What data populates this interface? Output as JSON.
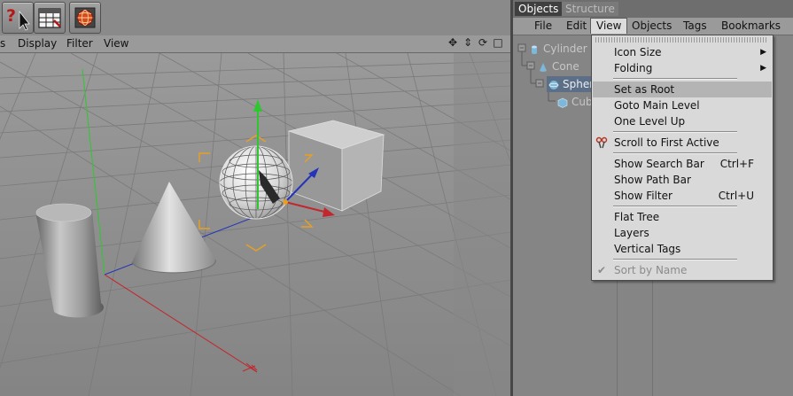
{
  "viewport": {
    "menus": [
      "s",
      "Display",
      "Filter",
      "View"
    ],
    "nav_icons": [
      "move-view-icon",
      "zoom-view-icon",
      "rotate-view-icon",
      "maximize-view-icon"
    ]
  },
  "toolbar": {
    "buttons": [
      "help-cursor-icon",
      "render-settings-icon",
      "render-view-icon"
    ]
  },
  "object_manager": {
    "tabs": [
      "Objects",
      "Structure"
    ],
    "menus": [
      "File",
      "Edit",
      "View",
      "Objects",
      "Tags",
      "Bookmarks"
    ],
    "open_menu": "View",
    "tree": [
      {
        "label": "Cylinder",
        "icon": "cylinder-icon",
        "selected": false
      },
      {
        "label": "Cone",
        "icon": "cone-icon",
        "selected": false
      },
      {
        "label": "Spher",
        "icon": "sphere-icon",
        "selected": true
      },
      {
        "label": "Cub",
        "icon": "cube-icon",
        "selected": false
      }
    ]
  },
  "view_menu": {
    "items": [
      {
        "label": "Icon Size",
        "submenu": true
      },
      {
        "label": "Folding",
        "submenu": true
      },
      {
        "label": "Set as Root",
        "highlighted": true
      },
      {
        "label": "Goto Main Level"
      },
      {
        "label": "One Level Up"
      },
      {
        "label": "Scroll to First Active",
        "icon": "scroll-to-active-icon"
      },
      {
        "label": "Show Search Bar",
        "shortcut": "Ctrl+F"
      },
      {
        "label": "Show Path Bar"
      },
      {
        "label": "Show Filter",
        "shortcut": "Ctrl+U"
      },
      {
        "label": "Flat Tree"
      },
      {
        "label": "Layers"
      },
      {
        "label": "Vertical Tags"
      },
      {
        "label": "Sort by Name",
        "disabled": true,
        "checked": true
      }
    ]
  },
  "colors": {
    "axis_x": "#c2272d",
    "axis_y": "#2ec82e",
    "axis_z": "#2535b8",
    "selection_handles": "#e8a020",
    "selected_row": "#5c6f86",
    "menu_highlight": "#b4b4b4"
  }
}
